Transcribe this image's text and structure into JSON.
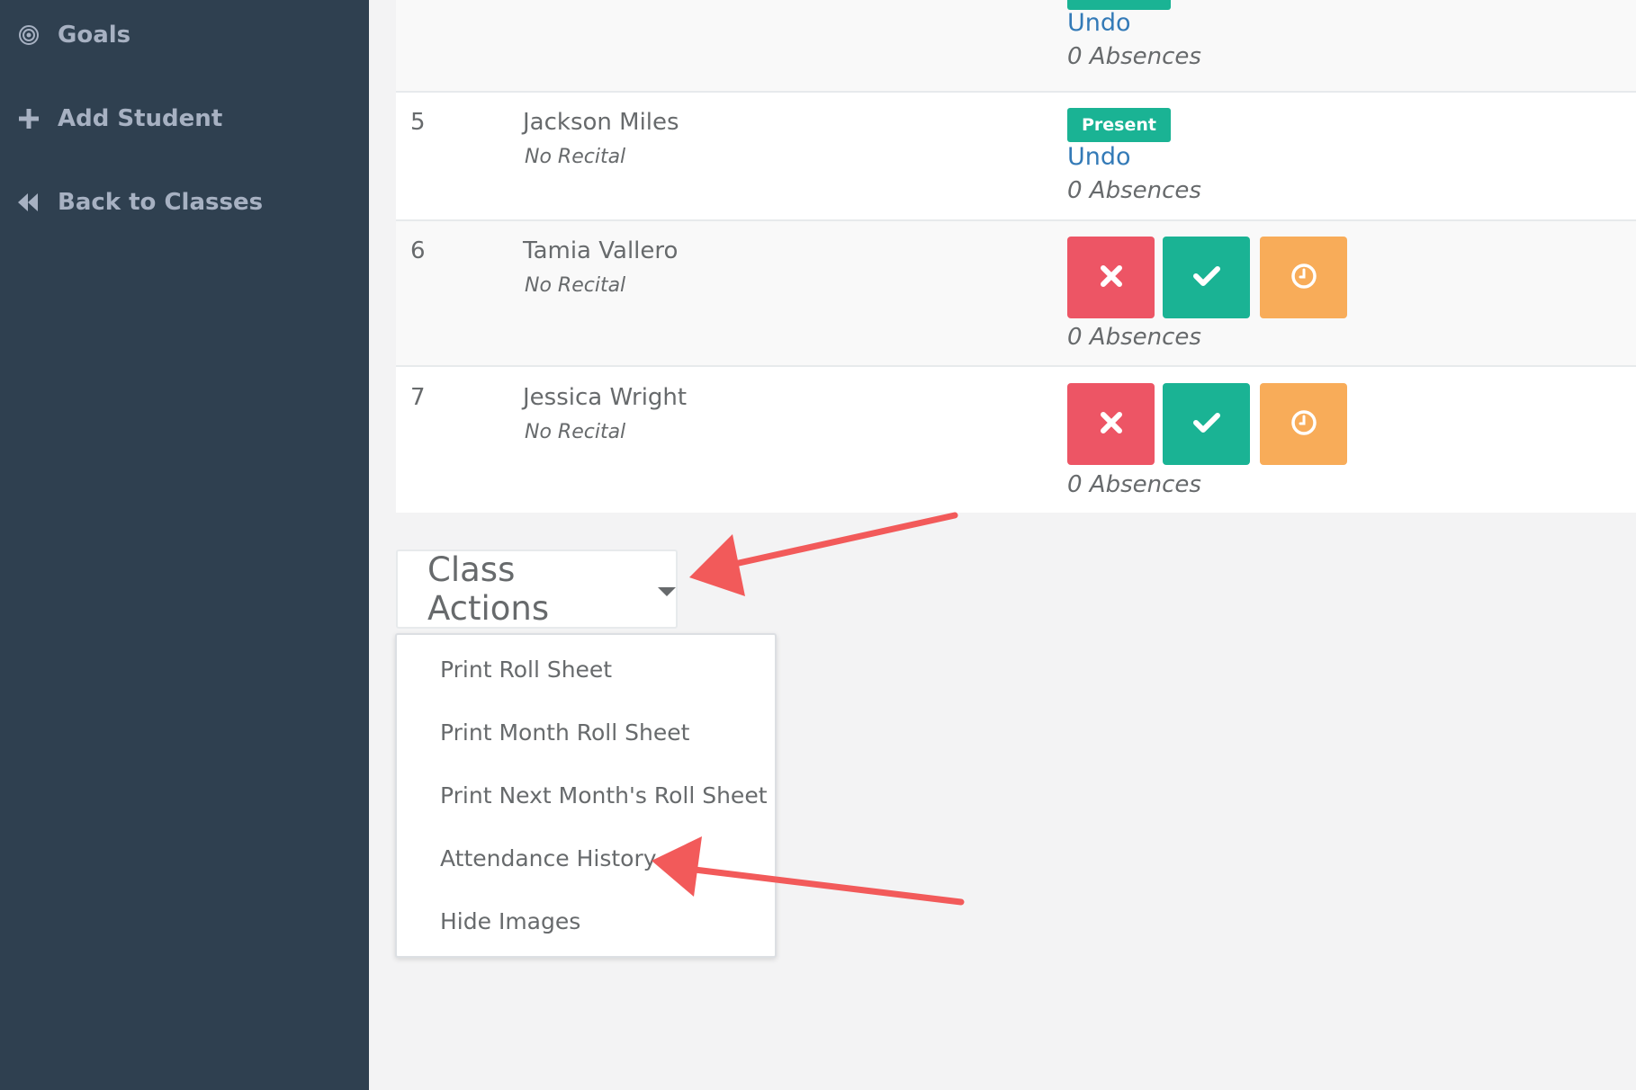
{
  "sidebar": {
    "items": [
      {
        "label": "Goals",
        "icon": "target-icon"
      },
      {
        "label": "Add Student",
        "icon": "plus-icon"
      },
      {
        "label": "Back to Classes",
        "icon": "fast-backward-icon"
      }
    ]
  },
  "roster": {
    "rows": [
      {
        "undo": "Undo",
        "absences": "0 Absences",
        "status": "Present"
      },
      {
        "number": "5",
        "name": "Jackson Miles",
        "recital": "No Recital",
        "status": "Present",
        "undo": "Undo",
        "absences": "0 Absences"
      },
      {
        "number": "6",
        "name": "Tamia Vallero",
        "recital": "No Recital",
        "absences": "0 Absences"
      },
      {
        "number": "7",
        "name": "Jessica Wright",
        "recital": "No Recital",
        "absences": "0 Absences"
      }
    ]
  },
  "class_actions": {
    "button_label": "Class Actions",
    "menu_items": [
      "Print Roll Sheet",
      "Print Month Roll Sheet",
      "Print Next Month's Roll Sheet",
      "Attendance History",
      "Hide Images"
    ]
  },
  "colors": {
    "sidebar_bg": "#2f4050",
    "present_green": "#1ab394",
    "absent_red": "#ed5565",
    "late_orange": "#f8ac59",
    "link_blue": "#337ab7",
    "annotation_arrow": "#f25a5a"
  }
}
